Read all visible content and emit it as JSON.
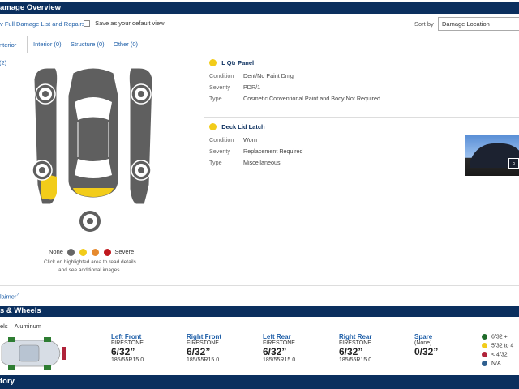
{
  "damage_overview": {
    "title": "amage Overview",
    "full_list_link": "v Full Damage List and Repairs",
    "default_view_label": "Save as your default view",
    "sort_label": "Sort by",
    "sort_value": "Damage Location"
  },
  "tabs": [
    {
      "label": "nterior (2)",
      "active": true
    },
    {
      "label": "Interior (0)",
      "active": false
    },
    {
      "label": "Structure (0)",
      "active": false
    },
    {
      "label": "Other (0)",
      "active": false
    }
  ],
  "damages": [
    {
      "title": "L Qtr Panel",
      "color": "#f2cc1a",
      "rows": [
        {
          "label": "Condition",
          "value": "Dent/No Paint Dmg"
        },
        {
          "label": "Severity",
          "value": "PDR/1"
        },
        {
          "label": "Type",
          "value": "Cosmetic Conventional Paint and Body Not Required"
        }
      ]
    },
    {
      "title": "Deck Lid Latch",
      "color": "#f2cc1a",
      "rows": [
        {
          "label": "Condition",
          "value": "Worn"
        },
        {
          "label": "Severity",
          "value": "Replacement Required"
        },
        {
          "label": "Type",
          "value": "Miscellaneous"
        }
      ]
    }
  ],
  "severity_legend": {
    "none_label": "None",
    "severe_label": "Severe",
    "colors": [
      "#666666",
      "#f2cc1a",
      "#e68a2e",
      "#c0181e"
    ],
    "hint_line1": "Click on highlighted area to read details",
    "hint_line2": "and see additional images."
  },
  "disclaimer": "laimer",
  "disclaimer_sup": "?",
  "tires": {
    "title": "s & Wheels",
    "wheels_label": "els",
    "wheels_value": "Aluminum",
    "columns": [
      {
        "heading": "Left Front",
        "brand": "FIRESTONE",
        "tread": "6/32”",
        "size": "185/55R15.0"
      },
      {
        "heading": "Right Front",
        "brand": "FIRESTONE",
        "tread": "6/32”",
        "size": "185/55R15.0"
      },
      {
        "heading": "Left Rear",
        "brand": "FIRESTONE",
        "tread": "6/32”",
        "size": "185/55R15.0"
      },
      {
        "heading": "Right Rear",
        "brand": "FIRESTONE",
        "tread": "6/32”",
        "size": "185/55R15.0"
      },
      {
        "heading": "Spare",
        "brand": "(None)",
        "tread": "0/32”",
        "size": ""
      }
    ],
    "legend": [
      {
        "label": "6/32 +",
        "color": "#1f6b2a"
      },
      {
        "label": "5/32 to 4",
        "color": "#f2cc1a"
      },
      {
        "label": "< 4/32",
        "color": "#b0233a"
      },
      {
        "label": "N/A",
        "color": "#2f5f8f"
      }
    ]
  },
  "history_title": "tory"
}
